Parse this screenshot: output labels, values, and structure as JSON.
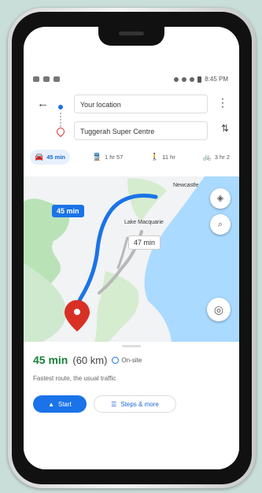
{
  "status_bar": {
    "time": "8:45 PM"
  },
  "directions": {
    "origin": "Your location",
    "destination": "Tuggerah Super Centre"
  },
  "modes": [
    {
      "label": "45 min",
      "icon": "car-icon",
      "active": true
    },
    {
      "label": "1 hr 57",
      "icon": "transit-icon",
      "active": false
    },
    {
      "label": "11 hr",
      "icon": "walk-icon",
      "active": false
    },
    {
      "label": "3 hr 2",
      "icon": "bike-icon",
      "active": false
    }
  ],
  "map": {
    "primary_time": "45 min",
    "alternate_time": "47 min",
    "place_newcastle": "Newcastle",
    "place_lake": "Lake Macquarie"
  },
  "route_card": {
    "time": "45 min",
    "distance": "(60 km)",
    "onsite_label": "On-site",
    "description": "Fastest route, the usual traffic",
    "start_label": "Start",
    "steps_label": "Steps & more"
  },
  "colors": {
    "accent": "#1a73e8",
    "time_green": "#188038",
    "destination_red": "#d93025"
  }
}
